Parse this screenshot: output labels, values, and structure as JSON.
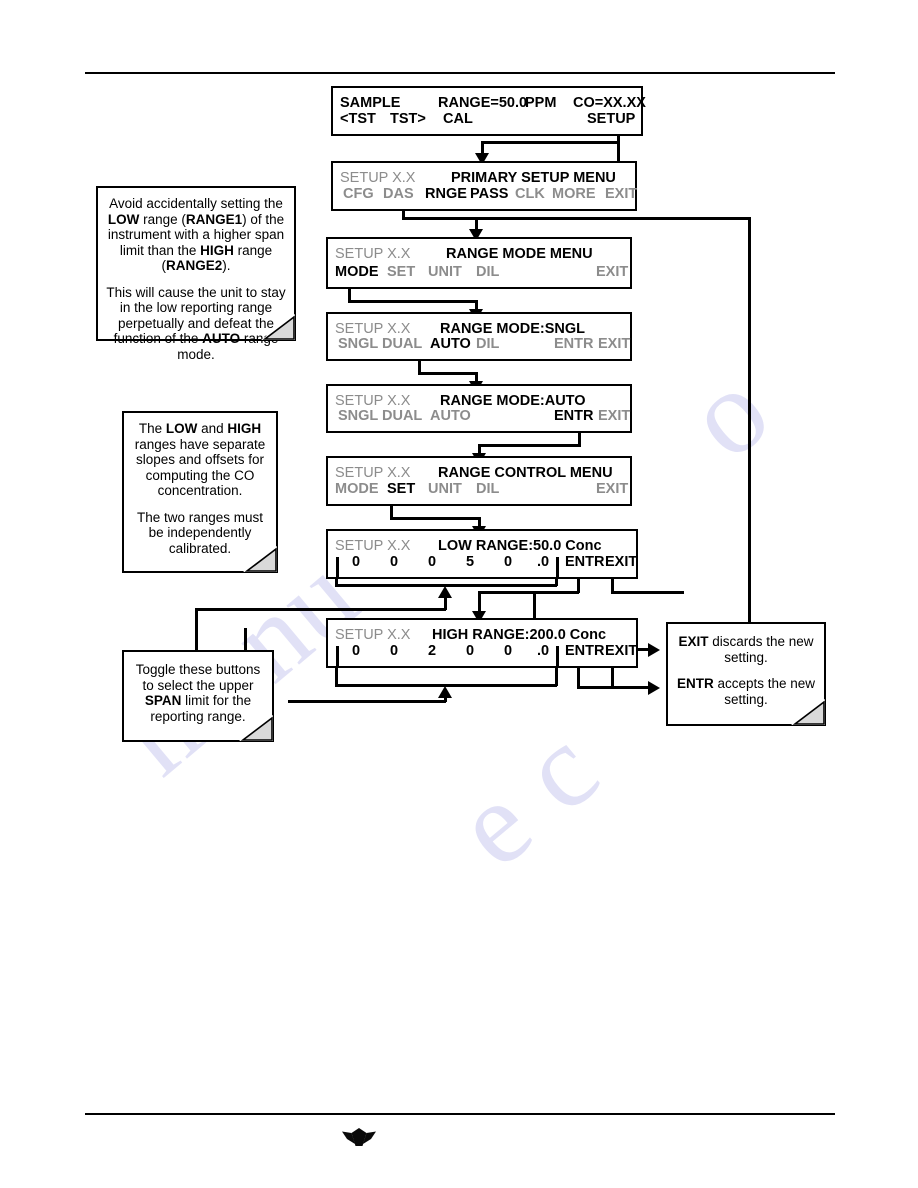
{
  "page": {
    "logo_name": "teledyne-logo-mark",
    "watermark_text": "manualslib.com",
    "watermark_fragments": [
      "manu",
      "o",
      "e c"
    ]
  },
  "displays": [
    {
      "id": "sample-display",
      "line1": [
        {
          "text": "SAMPLE",
          "style": "bold"
        },
        {
          "text": "RANGE=50.0",
          "style": "bold"
        },
        {
          "text": "PPM",
          "style": "bold"
        },
        {
          "text": "CO=XX.XX",
          "style": "bold"
        }
      ],
      "line2": [
        {
          "text": "<TST",
          "style": "bold"
        },
        {
          "text": "TST>",
          "style": "bold"
        },
        {
          "text": "CAL",
          "style": "bold"
        },
        {
          "text": "SETUP",
          "style": "bold"
        }
      ]
    },
    {
      "id": "primary-setup-menu",
      "prefix": "SETUP X.X",
      "title": "PRIMARY SETUP MENU",
      "buttons": [
        {
          "label": "CFG",
          "state": "dim"
        },
        {
          "label": "DAS",
          "state": "dim"
        },
        {
          "label": "RNGE",
          "state": "active"
        },
        {
          "label": "PASS",
          "state": "active"
        },
        {
          "label": "CLK",
          "state": "dim"
        },
        {
          "label": "MORE",
          "state": "dim"
        },
        {
          "label": "EXIT",
          "state": "dim"
        }
      ]
    },
    {
      "id": "range-mode-menu",
      "prefix": "SETUP X.X",
      "title": "RANGE MODE MENU",
      "buttons": [
        {
          "label": "MODE",
          "state": "active"
        },
        {
          "label": "SET",
          "state": "dim"
        },
        {
          "label": "UNIT",
          "state": "dim"
        },
        {
          "label": "DIL",
          "state": "dim"
        },
        {
          "label": "EXIT",
          "state": "dim"
        }
      ]
    },
    {
      "id": "range-mode-sngl",
      "prefix": "SETUP X.X",
      "title": "RANGE MODE:SNGL",
      "buttons": [
        {
          "label": "SNGL",
          "state": "dim"
        },
        {
          "label": "DUAL",
          "state": "dim"
        },
        {
          "label": "AUTO",
          "state": "active"
        },
        {
          "label": "DIL",
          "state": "dim"
        },
        {
          "label": "ENTR",
          "state": "dim"
        },
        {
          "label": "EXIT",
          "state": "dim"
        }
      ]
    },
    {
      "id": "range-mode-auto",
      "prefix": "SETUP X.X",
      "title": "RANGE MODE:AUTO",
      "buttons": [
        {
          "label": "SNGL",
          "state": "dim"
        },
        {
          "label": "DUAL",
          "state": "dim"
        },
        {
          "label": "AUTO",
          "state": "dim"
        },
        {
          "label": "ENTR",
          "state": "active"
        },
        {
          "label": "EXIT",
          "state": "dim"
        }
      ]
    },
    {
      "id": "range-control-menu",
      "prefix": "SETUP X.X",
      "title": "RANGE CONTROL MENU",
      "buttons": [
        {
          "label": "MODE",
          "state": "dim"
        },
        {
          "label": "SET",
          "state": "active"
        },
        {
          "label": "UNIT",
          "state": "dim"
        },
        {
          "label": "DIL",
          "state": "dim"
        },
        {
          "label": "EXIT",
          "state": "dim"
        }
      ]
    },
    {
      "id": "low-range-entry",
      "prefix": "SETUP X.X",
      "title": "LOW RANGE:50.0 Conc",
      "digits": [
        "0",
        "0",
        "0",
        "5",
        "0",
        ".0"
      ],
      "buttons": [
        {
          "label": "ENTR",
          "state": "active"
        },
        {
          "label": "EXIT",
          "state": "active"
        }
      ]
    },
    {
      "id": "high-range-entry",
      "prefix": "SETUP X.X",
      "title": "HIGH RANGE:200.0 Conc",
      "digits": [
        "0",
        "0",
        "2",
        "0",
        "0",
        ".0"
      ],
      "buttons": [
        {
          "label": "ENTR",
          "state": "active"
        },
        {
          "label": "EXIT",
          "state": "active"
        }
      ]
    }
  ],
  "notes": {
    "avoid_note": {
      "p1_a": "Avoid accidentally setting the ",
      "p1_low": "LOW",
      "p1_b": " range (",
      "p1_range1": "RANGE1",
      "p1_c": ") of the instrument with a higher span limit than the ",
      "p1_high": "HIGH",
      "p1_d": " range (",
      "p1_range2": "RANGE2",
      "p1_e": ").",
      "p2_a": "This will cause the unit to stay in the low reporting range perpetually and defeat the function of the ",
      "p2_auto": "AUTO",
      "p2_b": " range mode."
    },
    "slopes_note": {
      "p1_a": "The ",
      "p1_low": "LOW",
      "p1_b": " and ",
      "p1_high": "HIGH",
      "p1_c": " ranges have separate slopes and offsets for computing the CO concentration.",
      "p2": "The two ranges must be independently calibrated."
    },
    "toggle_note": {
      "p1_a": "Toggle these buttons to select the upper ",
      "p1_span": "SPAN",
      "p1_b": " limit for the reporting range."
    },
    "exit_entr_note": {
      "p1_exit": "EXIT",
      "p1_a": " discards the new setting.",
      "p2_entr": "ENTR",
      "p2_a": " accepts the new setting."
    }
  }
}
